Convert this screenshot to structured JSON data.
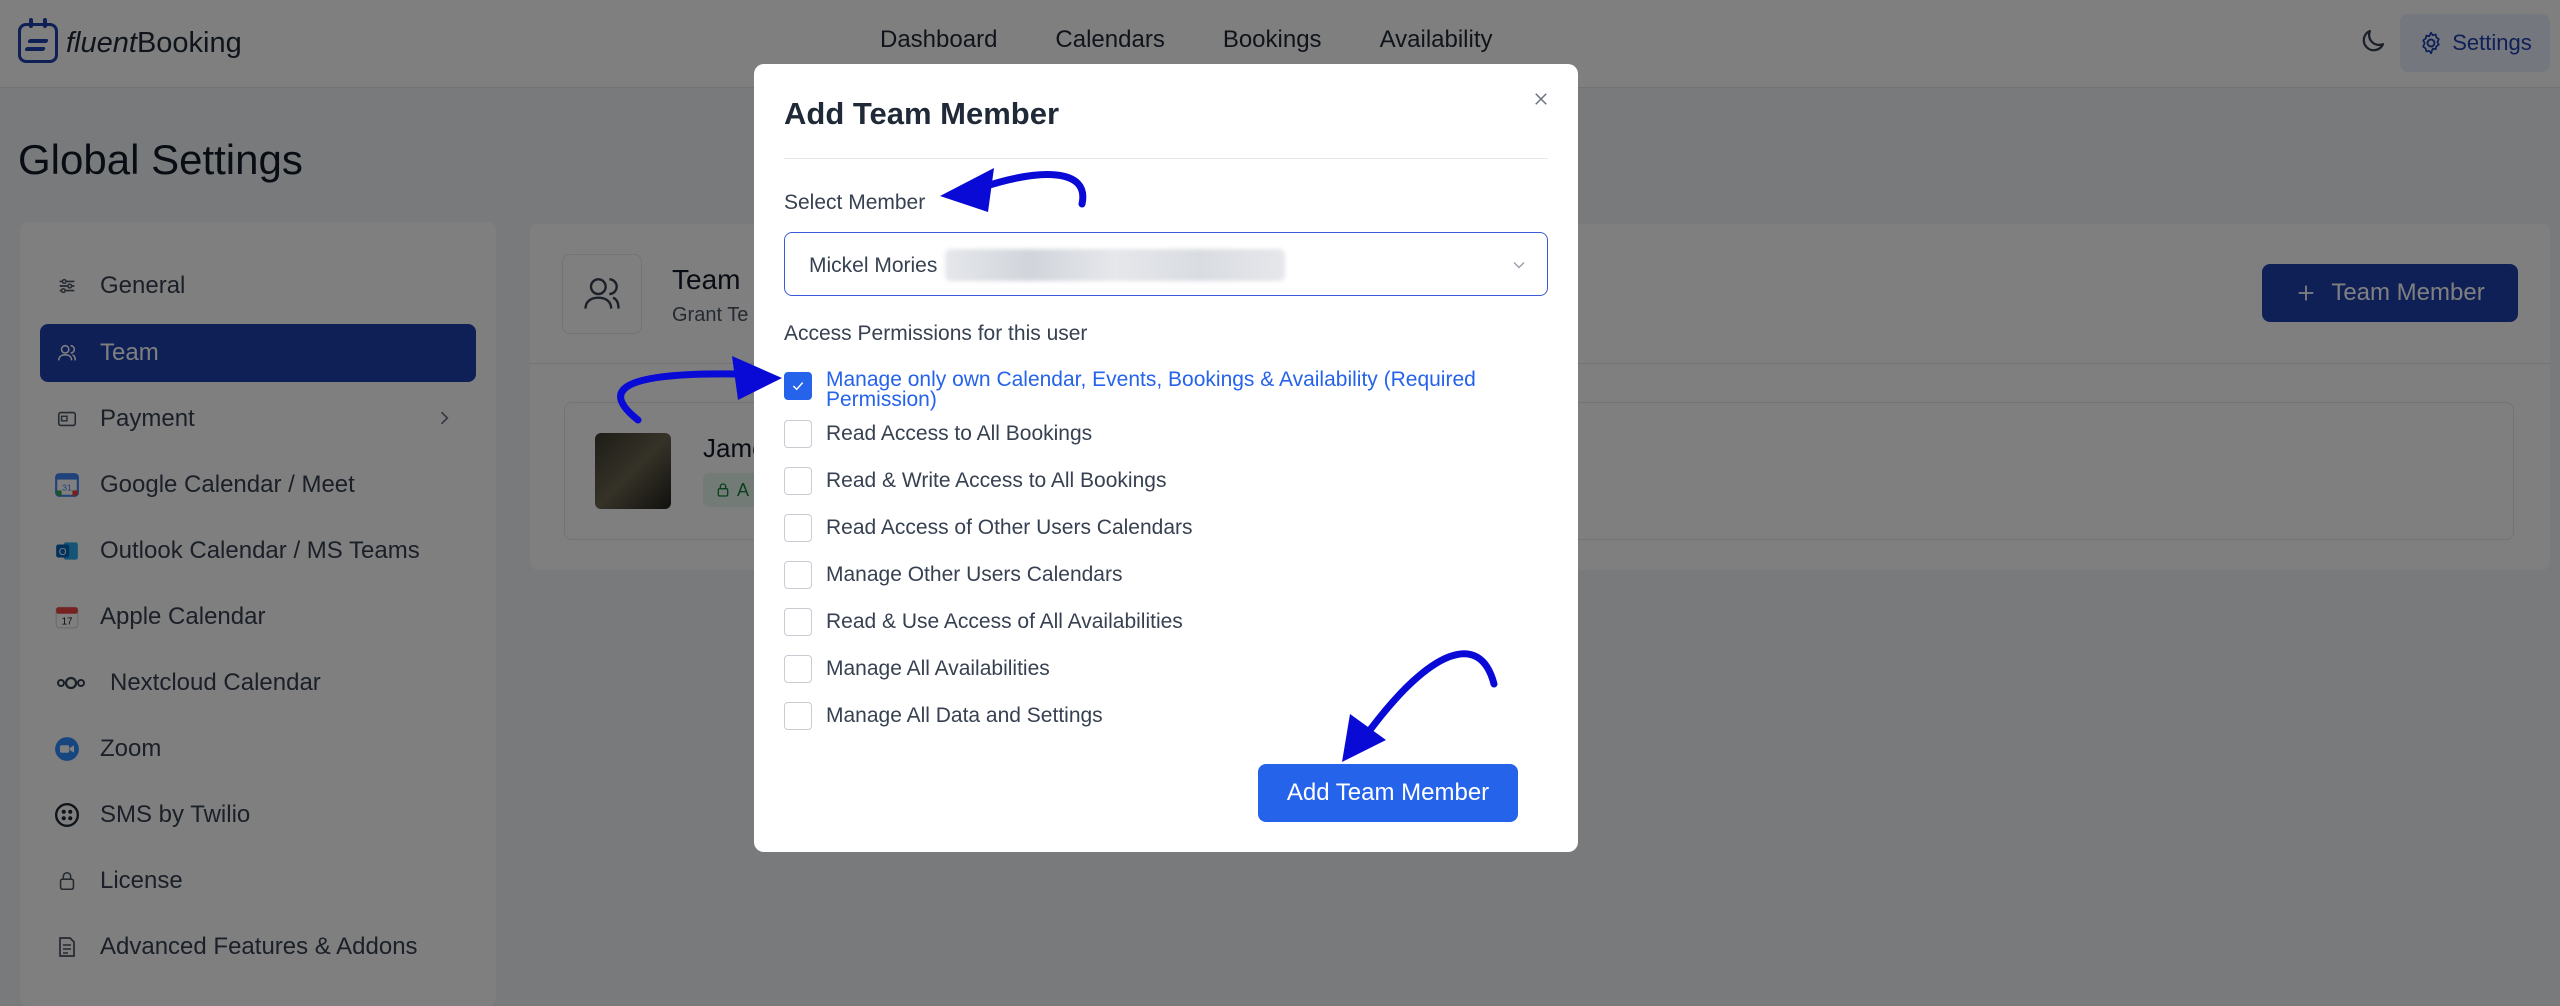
{
  "header": {
    "brand_prefix": "fluent",
    "brand_suffix": "Booking",
    "nav": [
      "Dashboard",
      "Calendars",
      "Bookings",
      "Availability"
    ],
    "settings_label": "Settings"
  },
  "page_title": "Global Settings",
  "sidebar": {
    "items": [
      {
        "label": "General",
        "icon": "sliders-icon"
      },
      {
        "label": "Team",
        "icon": "users-icon",
        "active": true
      },
      {
        "label": "Payment",
        "icon": "payment-icon"
      },
      {
        "label": "Google Calendar / Meet",
        "icon": "google-calendar-icon"
      },
      {
        "label": "Outlook Calendar / MS Teams",
        "icon": "outlook-icon"
      },
      {
        "label": "Apple Calendar",
        "icon": "apple-calendar-icon"
      },
      {
        "label": "Nextcloud Calendar",
        "icon": "nextcloud-icon"
      },
      {
        "label": "Zoom",
        "icon": "zoom-icon"
      },
      {
        "label": "SMS by Twilio",
        "icon": "twilio-icon"
      },
      {
        "label": "License",
        "icon": "lock-icon"
      },
      {
        "label": "Advanced Features & Addons",
        "icon": "document-icon"
      }
    ]
  },
  "main": {
    "team_title": "Team",
    "team_subtitle": "Grant Te",
    "add_button_label": "Team Member",
    "member_name": "Jame",
    "member_badge": "A"
  },
  "modal": {
    "title": "Add Team Member",
    "select_label": "Select Member",
    "selected_member": "Mickel Mories",
    "permissions_label": "Access Permissions for this user",
    "permissions": [
      {
        "label": "Manage only own Calendar, Events, Bookings & Availability (Required Permission)",
        "checked": true
      },
      {
        "label": "Read Access to All Bookings",
        "checked": false
      },
      {
        "label": "Read & Write Access to All Bookings",
        "checked": false
      },
      {
        "label": "Read Access of Other Users Calendars",
        "checked": false
      },
      {
        "label": "Manage Other Users Calendars",
        "checked": false
      },
      {
        "label": "Read & Use Access of All Availabilities",
        "checked": false
      },
      {
        "label": "Manage All Availabilities",
        "checked": false
      },
      {
        "label": "Manage All Data and Settings",
        "checked": false
      }
    ],
    "submit_label": "Add Team Member"
  },
  "colors": {
    "primary": "#2563eb",
    "brand_dark": "#1e40af",
    "annotation_arrow": "#0a0ad6"
  }
}
